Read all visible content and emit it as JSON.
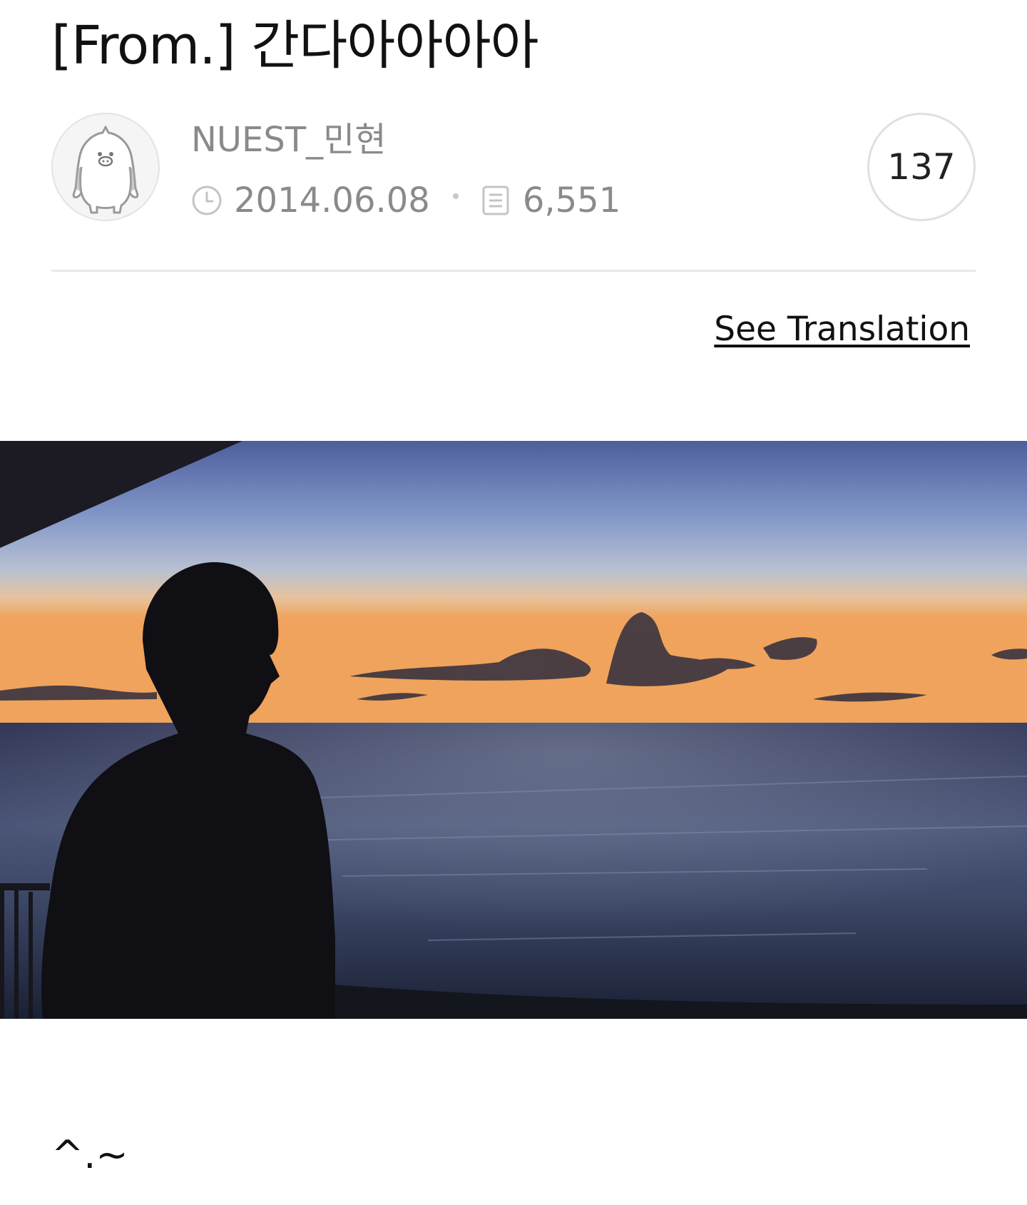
{
  "post": {
    "title": "[From.] 간다아아아아",
    "body": "^.~",
    "see_translation_label": "See Translation",
    "image_icon": "sunset-sea-photo"
  },
  "author": {
    "name": "NUEST_민현",
    "avatar_icon": "penguin-mascot-icon"
  },
  "meta": {
    "date": "2014.06.08",
    "date_icon": "clock-icon",
    "views": "6,551",
    "views_icon": "document-icon"
  },
  "comments": {
    "count": "137"
  }
}
